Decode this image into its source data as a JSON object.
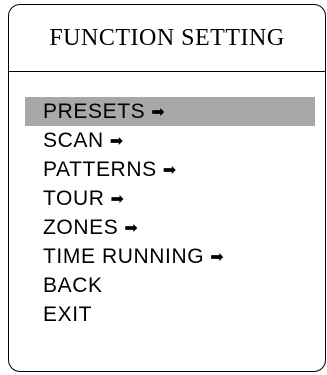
{
  "title": "FUNCTION SETTING",
  "menu": {
    "selected_index": 0,
    "arrow_glyph": "➡",
    "items": [
      {
        "label": "PRESETS",
        "has_submenu": true
      },
      {
        "label": "SCAN",
        "has_submenu": true
      },
      {
        "label": "PATTERNS",
        "has_submenu": true
      },
      {
        "label": "TOUR",
        "has_submenu": true
      },
      {
        "label": "ZONES",
        "has_submenu": true
      },
      {
        "label": "TIME RUNNING",
        "has_submenu": true
      },
      {
        "label": "BACK",
        "has_submenu": false
      },
      {
        "label": "EXIT",
        "has_submenu": false
      }
    ]
  },
  "colors": {
    "selection_highlight": "#a8a8a8",
    "text": "#000000",
    "background": "#ffffff"
  }
}
